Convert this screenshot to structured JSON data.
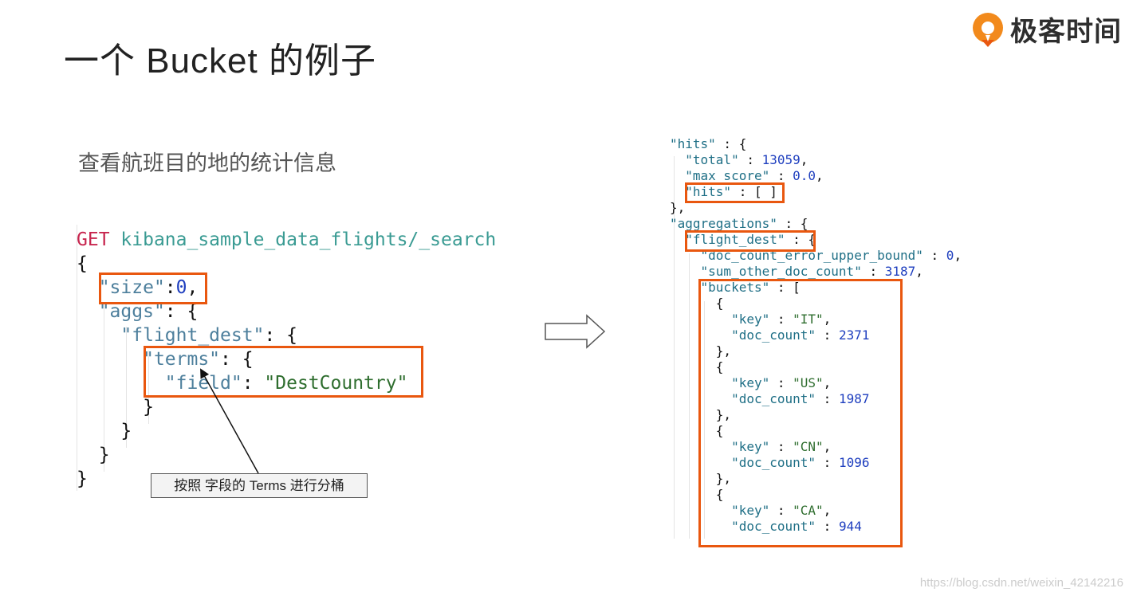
{
  "slide": {
    "title": "一个 Bucket 的例子",
    "subtitle": "查看航班目的地的统计信息",
    "brand": {
      "name": "极客时间",
      "accent_color": "#f28a1c"
    },
    "annotation": "按照 字段的 Terms 进行分桶",
    "watermark": "https://blog.csdn.net/weixin_42142216",
    "highlight_color": "#e9570f"
  },
  "request": {
    "method": "GET",
    "path": "kibana_sample_data_flights/_search",
    "size_key": "\"size\"",
    "size_value": "0",
    "aggs_key": "\"aggs\"",
    "agg_name_key": "\"flight_dest\"",
    "terms_key": "\"terms\"",
    "field_key": "\"field\"",
    "field_value": "\"DestCountry\""
  },
  "response": {
    "hits_key": "\"hits\"",
    "total_key": "\"total\"",
    "total_value": "13059",
    "max_score_key": "\"max_score\"",
    "max_score_value": "0.0",
    "hits_array_key": "\"hits\"",
    "hits_array_value": "[ ]",
    "aggregations_key": "\"aggregations\"",
    "flight_dest_key": "\"flight_dest\"",
    "doc_count_error_key": "\"doc_count_error_upper_bound\"",
    "doc_count_error_value": "0",
    "sum_other_key": "\"sum_other_doc_count\"",
    "sum_other_value": "3187",
    "buckets_key": "\"buckets\"",
    "bucket_key_label": "\"key\"",
    "bucket_count_label": "\"doc_count\"",
    "buckets": [
      {
        "key": "\"IT\"",
        "doc_count": "2371"
      },
      {
        "key": "\"US\"",
        "doc_count": "1987"
      },
      {
        "key": "\"CN\"",
        "doc_count": "1096"
      },
      {
        "key": "\"CA\"",
        "doc_count": "944"
      }
    ]
  }
}
